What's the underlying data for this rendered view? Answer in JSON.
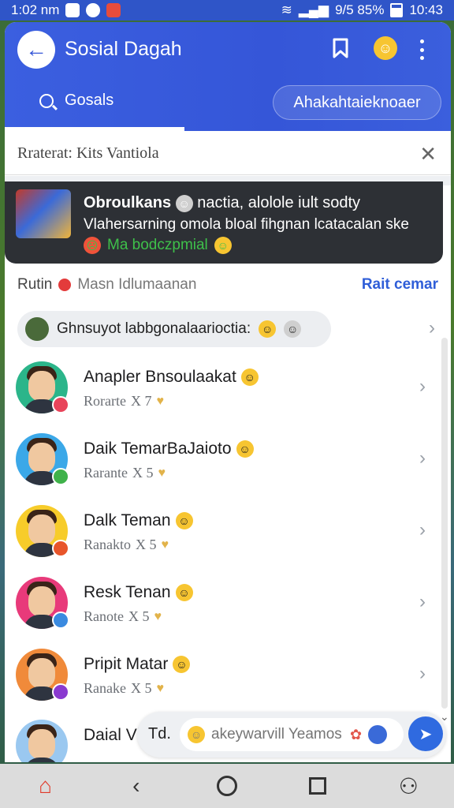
{
  "status_bar": {
    "time": "1:02 nm",
    "right_text": "9/5 85%",
    "right_time": "10:43"
  },
  "header": {
    "title": "Sosial Dagah",
    "tab_label": "Gosals",
    "pill_button": "Ahakahtaieknoaer"
  },
  "filter": {
    "label": "Rraterat:",
    "value": "Kits Vantiola"
  },
  "notification": {
    "line1_bold": "Obroulkans",
    "line1_rest": "nactia, alolole iult sodty",
    "line2": "Vlahersarning omola bloal fihgnan lcatacalan ske",
    "line3": "Ma bodczpmial"
  },
  "section": {
    "title": "Rutin",
    "subtitle": "Masn Idlumaanan",
    "link": "Rait cemar"
  },
  "group": {
    "label": "Ghnsuyot labbgonalaarioctia:"
  },
  "friends": [
    {
      "name": "Anapler Bnsoulaakat",
      "meta_word": "Rorarte",
      "meta_count": "X 7",
      "bg": "#2bb58a",
      "badge": "#e8445a"
    },
    {
      "name": "Daik TemarBaJaioto",
      "meta_word": "Rarante",
      "meta_count": "X 5",
      "bg": "#3ba8e8",
      "badge": "#3fb24a"
    },
    {
      "name": "Dalk Teman",
      "meta_word": "Ranakto",
      "meta_count": "X 5",
      "bg": "#f7cc2a",
      "badge": "#e8552a"
    },
    {
      "name": "Resk Tenan",
      "meta_word": "Ranote",
      "meta_count": "X 5",
      "bg": "#e83a7a",
      "badge": "#3a8ae0"
    },
    {
      "name": "Pripit Matar",
      "meta_word": "Ranake",
      "meta_count": "X 5",
      "bg": "#f08a3a",
      "badge": "#8a3ad0"
    }
  ],
  "partial_friend": {
    "name": "Daial Vl",
    "bg": "#9ac8f0"
  },
  "composer": {
    "prefix": "Td.",
    "placeholder": "akeywarvill Yeamos"
  }
}
